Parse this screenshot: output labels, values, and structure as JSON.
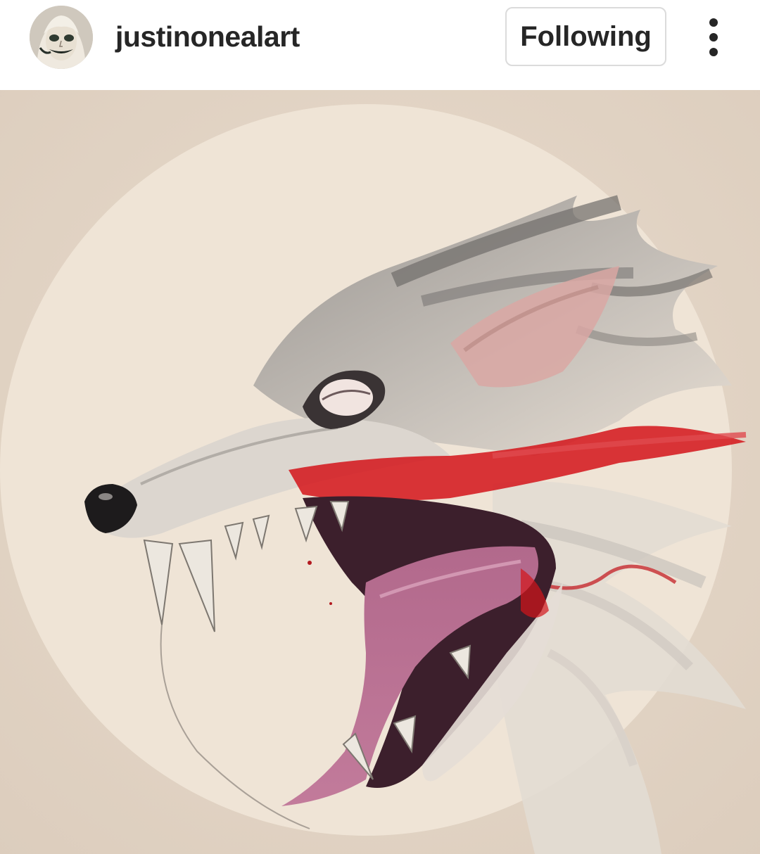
{
  "post": {
    "username": "justinonealart",
    "follow_label": "Following",
    "more_icon": "more-vertical-icon"
  },
  "colors": {
    "text": "#262626",
    "button_border": "#dbdbdb",
    "paper": "#e4d6c7",
    "moon": "#efe3d5",
    "blood": "#d3141a"
  }
}
